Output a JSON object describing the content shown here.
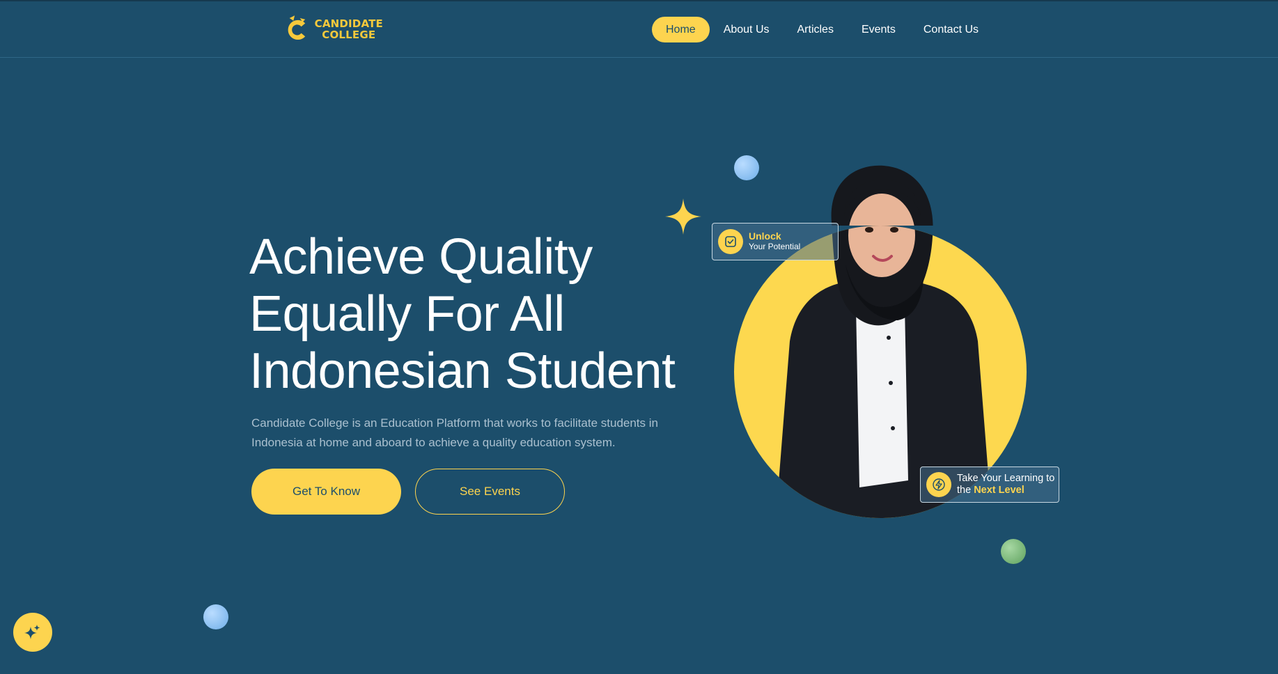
{
  "brand": {
    "logo_line1": "CANDIDATE",
    "logo_line2": "COLLEGE",
    "icon": "candidate-college-logo"
  },
  "nav": {
    "items": [
      {
        "label": "Home",
        "active": true
      },
      {
        "label": "About Us",
        "active": false
      },
      {
        "label": "Articles",
        "active": false
      },
      {
        "label": "Events",
        "active": false
      },
      {
        "label": "Contact Us",
        "active": false
      }
    ]
  },
  "hero": {
    "title_lines": [
      "Achieve Quality",
      "Equally For All",
      "Indonesian Student"
    ],
    "description": "Candidate College is an Education Platform that works to facilitate students in Indonesia at home and aboard to achieve a quality education system.",
    "primary_button": "Get To Know",
    "secondary_button": "See Events"
  },
  "badges": {
    "unlock": {
      "title": "Unlock",
      "subtitle": "Your Potential",
      "icon": "check-square-icon"
    },
    "next_level": {
      "line1": "Take Your Learning to",
      "prefix": "the ",
      "highlight": "Next Level",
      "icon": "lightning-icon"
    }
  },
  "fab": {
    "icon": "sparkles-icon"
  },
  "colors": {
    "background": "#1c4e6b",
    "accent": "#fdd44f",
    "text": "#ffffff",
    "muted_text": "#aac0cf"
  }
}
